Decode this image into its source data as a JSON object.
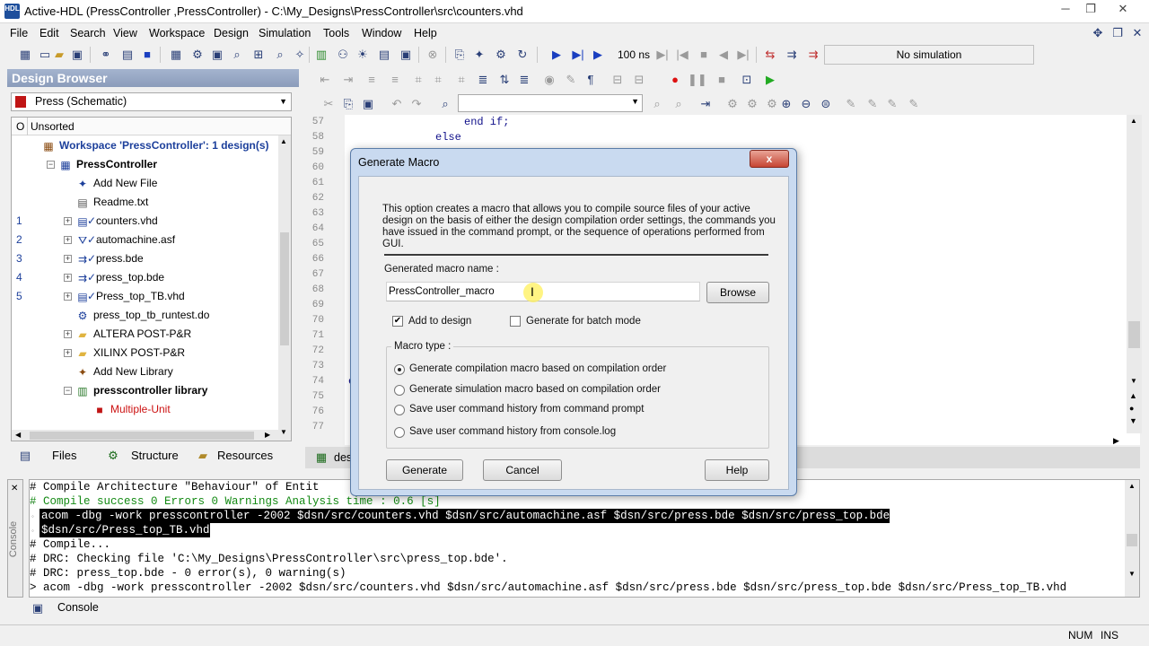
{
  "window": {
    "title": "Active-HDL (PressController ,PressController) - C:\\My_Designs\\PressController\\src\\counters.vhd",
    "app_icon_text": "HDL",
    "minimize": "─",
    "restore": "❐",
    "close": "✕"
  },
  "menu": {
    "items": [
      "File",
      "Edit",
      "Search",
      "View",
      "Workspace",
      "Design",
      "Simulation",
      "Tools",
      "Window",
      "Help"
    ]
  },
  "toolbar": {
    "sim_time": "100 ns",
    "sim_status": "No simulation"
  },
  "design_browser": {
    "header": "Design Browser",
    "combo_value": "Press (Schematic)",
    "column_o": "O",
    "column_sort": "Unsorted",
    "tree": [
      {
        "num": "",
        "label": "Workspace 'PressController': 1 design(s)",
        "indent": 0,
        "icon": "workspace-icon",
        "bold": true,
        "color": "#1c3f9b"
      },
      {
        "num": "",
        "label": "PressController",
        "indent": 1,
        "icon": "design-icon",
        "bold": true,
        "color": "#000",
        "expander": "−"
      },
      {
        "num": "",
        "label": "Add New File",
        "indent": 2,
        "icon": "add-file-icon",
        "color": "#000"
      },
      {
        "num": "",
        "label": "Readme.txt",
        "indent": 2,
        "icon": "text-file-icon",
        "color": "#000"
      },
      {
        "num": "1",
        "label": "counters.vhd",
        "indent": 2,
        "icon": "vhdl-file-icon",
        "check": true,
        "color": "#000",
        "expander": "+"
      },
      {
        "num": "2",
        "label": "automachine.asf",
        "indent": 2,
        "icon": "state-machine-icon",
        "check": true,
        "color": "#000",
        "expander": "+"
      },
      {
        "num": "3",
        "label": "press.bde",
        "indent": 2,
        "icon": "block-diagram-icon",
        "check": true,
        "color": "#000",
        "expander": "+"
      },
      {
        "num": "4",
        "label": "press_top.bde",
        "indent": 2,
        "icon": "block-diagram-icon",
        "check": true,
        "color": "#000",
        "expander": "+"
      },
      {
        "num": "5",
        "label": "Press_top_TB.vhd",
        "indent": 2,
        "icon": "testbench-icon",
        "check": true,
        "color": "#000",
        "expander": "+"
      },
      {
        "num": "",
        "label": "press_top_tb_runtest.do",
        "indent": 2,
        "icon": "macro-file-icon",
        "color": "#000"
      },
      {
        "num": "",
        "label": "ALTERA POST-P&R",
        "indent": 2,
        "icon": "folder-icon",
        "color": "#000",
        "expander": "+"
      },
      {
        "num": "",
        "label": "XILINX POST-P&R",
        "indent": 2,
        "icon": "folder-icon",
        "color": "#000",
        "expander": "+"
      },
      {
        "num": "",
        "label": "Add New Library",
        "indent": 2,
        "icon": "add-library-icon",
        "color": "#000"
      },
      {
        "num": "",
        "label": "presscontroller library",
        "indent": 2,
        "icon": "library-icon",
        "bold": true,
        "color": "#000",
        "expander": "−"
      },
      {
        "num": "",
        "label": "Multiple-Unit",
        "indent": 3,
        "icon": "unit-icon",
        "color": "#cc1111"
      }
    ],
    "tabs": [
      "Files",
      "Structure",
      "Resources"
    ]
  },
  "editor": {
    "lines": [
      {
        "num": "57",
        "code": "end if;",
        "indent": 131
      },
      {
        "num": "58",
        "code": "else",
        "indent": 99
      },
      {
        "num": "59",
        "code": "",
        "indent": 0
      },
      {
        "num": "60",
        "code": "",
        "indent": 0
      },
      {
        "num": "61",
        "code": "",
        "indent": 0
      },
      {
        "num": "62",
        "code": "",
        "indent": 0
      },
      {
        "num": "63",
        "code": "",
        "indent": 0
      },
      {
        "num": "64",
        "code": "",
        "indent": 0
      },
      {
        "num": "65",
        "code": "",
        "indent": 0
      },
      {
        "num": "66",
        "code": "",
        "indent": 0
      },
      {
        "num": "67",
        "code": "",
        "indent": 0
      },
      {
        "num": "68",
        "code": "",
        "indent": 0
      },
      {
        "num": "69",
        "code": "",
        "indent": 0
      },
      {
        "num": "70",
        "code": "",
        "indent": 0
      },
      {
        "num": "71",
        "code": "",
        "indent": 0
      },
      {
        "num": "72",
        "code": "",
        "indent": 0
      },
      {
        "num": "73",
        "code": "",
        "indent": 0
      },
      {
        "num": "74",
        "code": "e",
        "indent": 2
      },
      {
        "num": "75",
        "code": "",
        "indent": 0
      },
      {
        "num": "76",
        "code": "",
        "indent": 0
      },
      {
        "num": "77",
        "code": "",
        "indent": 0
      }
    ],
    "tab_label": "des"
  },
  "console": {
    "lines": [
      {
        "text": "# Compile Architecture \"Behaviour\" of Entit",
        "style": "normal"
      },
      {
        "text": "# Compile success 0 Errors 0 Warnings  Analysis time :  0.6 [s]",
        "style": "green"
      },
      {
        "text": "acom -dbg -work presscontroller -2002  $dsn/src/counters.vhd $dsn/src/automachine.asf $dsn/src/press.bde $dsn/src/press_top.bde",
        "style": "hl"
      },
      {
        "text": "$dsn/src/Press_top_TB.vhd",
        "style": "hl"
      },
      {
        "text": "# Compile...",
        "style": "normal"
      },
      {
        "text": "# DRC: Checking file 'C:\\My_Designs\\PressController\\src\\press_top.bde'.",
        "style": "normal"
      },
      {
        "text": "# DRC: press_top.bde - 0 error(s), 0 warning(s)",
        "style": "normal"
      },
      {
        "text": "> acom -dbg -work presscontroller -2002  $dsn/src/counters.vhd $dsn/src/automachine.asf $dsn/src/press.bde $dsn/src/press_top.bde $dsn/src/Press_top_TB.vhd",
        "style": "normal"
      }
    ],
    "side_label": "Console",
    "tab_label": "Console"
  },
  "status": {
    "num": "NUM",
    "ins": "INS"
  },
  "dialog": {
    "title": "Generate Macro",
    "close_label": "x",
    "description": "This option creates a macro that allows you to compile source files of your active design on the basis of either the design compilation order settings, the commands you have issued in the command prompt, or the sequence of operations performed from GUI.",
    "name_label": "Generated macro name :",
    "name_value": "PressController_macro",
    "browse": "Browse",
    "add_to_design": "Add to design",
    "add_to_design_checked": true,
    "batch_mode": "Generate for batch mode",
    "batch_mode_checked": false,
    "macro_type_label": "Macro type :",
    "options": [
      {
        "label": "Generate compilation macro based on compilation order",
        "selected": true
      },
      {
        "label": "Generate simulation macro based on compilation order",
        "selected": false
      },
      {
        "label": "Save user command history from command prompt",
        "selected": false
      },
      {
        "label": "Save user command history from console.log",
        "selected": false
      }
    ],
    "generate": "Generate",
    "cancel": "Cancel",
    "help": "Help"
  }
}
